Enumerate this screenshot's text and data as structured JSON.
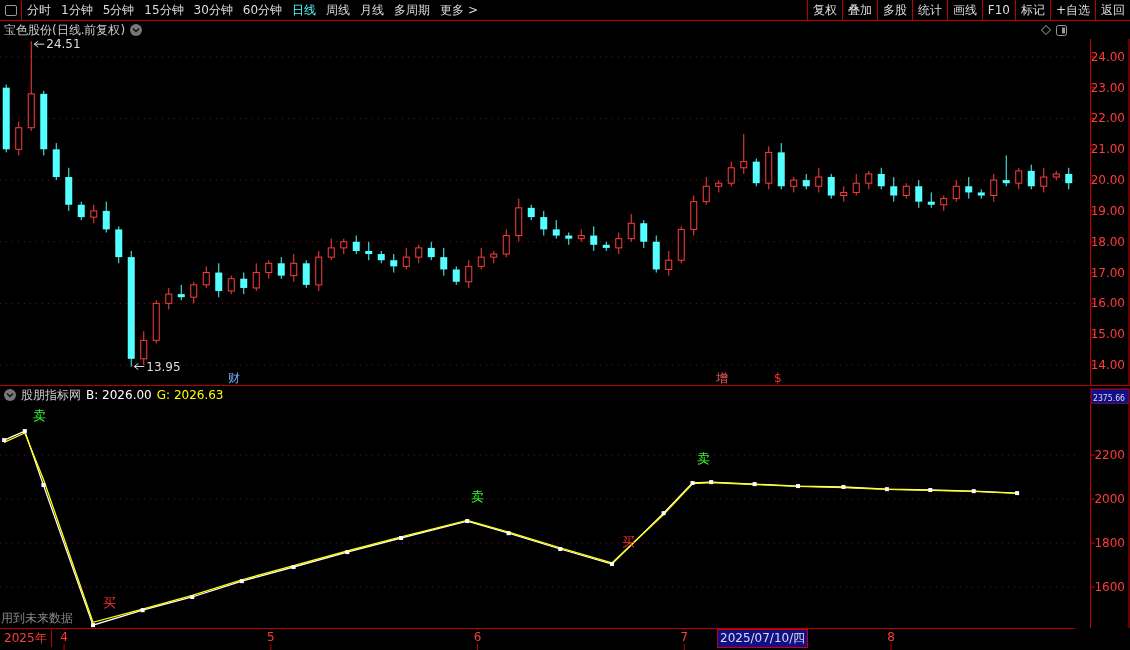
{
  "toolbar": {
    "periods": [
      {
        "label": "分时",
        "selected": false
      },
      {
        "label": "1分钟",
        "selected": false
      },
      {
        "label": "5分钟",
        "selected": false
      },
      {
        "label": "15分钟",
        "selected": false
      },
      {
        "label": "30分钟",
        "selected": false
      },
      {
        "label": "60分钟",
        "selected": false
      },
      {
        "label": "日线",
        "selected": true
      },
      {
        "label": "周线",
        "selected": false
      },
      {
        "label": "月线",
        "selected": false
      },
      {
        "label": "多周期",
        "selected": false
      },
      {
        "label": "更多 >",
        "selected": false
      }
    ],
    "buttons": [
      "复权",
      "叠加",
      "多股",
      "统计",
      "画线",
      "F10",
      "标记",
      "+自选",
      "返回"
    ]
  },
  "price_chart": {
    "title": "宝色股份(日线.前复权)",
    "high_label": "24.51",
    "low_label": "13.95",
    "events": [
      {
        "label": "财",
        "kind": "finance"
      },
      {
        "label": "增",
        "kind": "increase"
      },
      {
        "label": "$",
        "kind": "dividend"
      }
    ],
    "chart_data": {
      "type": "candlestick",
      "ylim": [
        13.35,
        24.58
      ],
      "grid": true,
      "yticks": [
        {
          "value": 24,
          "label": "24.00"
        },
        {
          "value": 23,
          "label": "23.00"
        },
        {
          "value": 22,
          "label": "22.00"
        },
        {
          "value": 21,
          "label": "21.00"
        },
        {
          "value": 20,
          "label": "20.00"
        },
        {
          "value": 19,
          "label": "19.00"
        },
        {
          "value": 18,
          "label": "18.00"
        },
        {
          "value": 17,
          "label": "17.00"
        },
        {
          "value": 16,
          "label": "16.00"
        },
        {
          "value": 15,
          "label": "15.00"
        },
        {
          "value": 14,
          "label": "14.00"
        }
      ],
      "categories": [
        null,
        null,
        null,
        null,
        null,
        null,
        null,
        null,
        null,
        null,
        null,
        null,
        null,
        null,
        null,
        null,
        null,
        null,
        null,
        null,
        null,
        null,
        null,
        null,
        null,
        null,
        null,
        null,
        null,
        null,
        null,
        null,
        null,
        null,
        null,
        null,
        null,
        null,
        null,
        null,
        null,
        null,
        null,
        null,
        null,
        null,
        null,
        null,
        null,
        null,
        null,
        null,
        null,
        null,
        null,
        null,
        null,
        null,
        null,
        null,
        null,
        null,
        null,
        null,
        null,
        null,
        null,
        null,
        null,
        null,
        null,
        null,
        null,
        null,
        null,
        null,
        null,
        null,
        null,
        null,
        null,
        null,
        null,
        null,
        null,
        null
      ],
      "ohlc": [
        [
          23.0,
          23.1,
          20.9,
          21.0
        ],
        [
          21.0,
          21.9,
          20.8,
          21.7
        ],
        [
          21.7,
          24.51,
          21.6,
          22.8
        ],
        [
          22.8,
          22.9,
          20.8,
          21.0
        ],
        [
          21.0,
          21.2,
          20.0,
          20.1
        ],
        [
          20.1,
          20.4,
          19.0,
          19.2
        ],
        [
          19.2,
          19.3,
          18.7,
          18.8
        ],
        [
          18.8,
          19.2,
          18.6,
          19.0
        ],
        [
          19.0,
          19.3,
          18.3,
          18.4
        ],
        [
          18.4,
          18.5,
          17.3,
          17.5
        ],
        [
          17.5,
          17.7,
          13.95,
          14.2
        ],
        [
          14.2,
          15.1,
          14.0,
          14.8
        ],
        [
          14.8,
          16.1,
          14.7,
          16.0
        ],
        [
          16.0,
          16.5,
          15.8,
          16.3
        ],
        [
          16.3,
          16.6,
          16.1,
          16.2
        ],
        [
          16.2,
          16.7,
          16.0,
          16.6
        ],
        [
          16.6,
          17.2,
          16.5,
          17.0
        ],
        [
          17.0,
          17.3,
          16.2,
          16.4
        ],
        [
          16.4,
          16.9,
          16.3,
          16.8
        ],
        [
          16.8,
          17.0,
          16.3,
          16.5
        ],
        [
          16.5,
          17.3,
          16.4,
          17.0
        ],
        [
          17.0,
          17.4,
          16.8,
          17.3
        ],
        [
          17.3,
          17.5,
          16.8,
          16.9
        ],
        [
          16.9,
          17.6,
          16.7,
          17.3
        ],
        [
          17.3,
          17.4,
          16.5,
          16.6
        ],
        [
          16.6,
          17.7,
          16.4,
          17.5
        ],
        [
          17.5,
          18.1,
          17.4,
          17.8
        ],
        [
          17.8,
          18.1,
          17.6,
          18.0
        ],
        [
          18.0,
          18.2,
          17.6,
          17.7
        ],
        [
          17.7,
          18.0,
          17.4,
          17.6
        ],
        [
          17.6,
          17.7,
          17.3,
          17.4
        ],
        [
          17.4,
          17.6,
          17.0,
          17.2
        ],
        [
          17.2,
          17.8,
          17.1,
          17.5
        ],
        [
          17.5,
          17.9,
          17.3,
          17.8
        ],
        [
          17.8,
          18.0,
          17.4,
          17.5
        ],
        [
          17.5,
          17.8,
          16.9,
          17.1
        ],
        [
          17.1,
          17.2,
          16.6,
          16.7
        ],
        [
          16.7,
          17.4,
          16.5,
          17.2
        ],
        [
          17.2,
          17.8,
          17.1,
          17.5
        ],
        [
          17.5,
          17.7,
          17.3,
          17.6
        ],
        [
          17.6,
          18.4,
          17.5,
          18.2
        ],
        [
          18.2,
          19.4,
          18.0,
          19.1
        ],
        [
          19.1,
          19.2,
          18.7,
          18.8
        ],
        [
          18.8,
          19.0,
          18.2,
          18.4
        ],
        [
          18.4,
          18.7,
          18.1,
          18.2
        ],
        [
          18.2,
          18.3,
          17.9,
          18.1
        ],
        [
          18.1,
          18.4,
          18.0,
          18.2
        ],
        [
          18.2,
          18.5,
          17.7,
          17.9
        ],
        [
          17.9,
          18.0,
          17.7,
          17.8
        ],
        [
          17.8,
          18.3,
          17.6,
          18.1
        ],
        [
          18.1,
          18.9,
          18.0,
          18.6
        ],
        [
          18.6,
          18.7,
          17.8,
          18.0
        ],
        [
          18.0,
          18.2,
          17.0,
          17.1
        ],
        [
          17.1,
          17.7,
          16.9,
          17.4
        ],
        [
          17.4,
          18.5,
          17.3,
          18.4
        ],
        [
          18.4,
          19.5,
          18.2,
          19.3
        ],
        [
          19.3,
          20.1,
          19.2,
          19.8
        ],
        [
          19.8,
          20.0,
          19.6,
          19.9
        ],
        [
          19.9,
          20.6,
          19.8,
          20.4
        ],
        [
          20.4,
          21.5,
          20.2,
          20.6
        ],
        [
          20.6,
          20.7,
          19.8,
          19.9
        ],
        [
          19.9,
          21.1,
          19.7,
          20.9
        ],
        [
          20.9,
          21.2,
          19.7,
          19.8
        ],
        [
          19.8,
          20.1,
          19.6,
          20.0
        ],
        [
          20.0,
          20.2,
          19.7,
          19.8
        ],
        [
          19.8,
          20.4,
          19.6,
          20.1
        ],
        [
          20.1,
          20.2,
          19.4,
          19.5
        ],
        [
          19.5,
          19.8,
          19.3,
          19.6
        ],
        [
          19.6,
          20.2,
          19.5,
          19.9
        ],
        [
          19.9,
          20.3,
          19.7,
          20.2
        ],
        [
          20.2,
          20.4,
          19.7,
          19.8
        ],
        [
          19.8,
          20.1,
          19.3,
          19.5
        ],
        [
          19.5,
          19.9,
          19.4,
          19.8
        ],
        [
          19.8,
          20.0,
          19.1,
          19.3
        ],
        [
          19.3,
          19.6,
          19.1,
          19.2
        ],
        [
          19.2,
          19.5,
          19.0,
          19.4
        ],
        [
          19.4,
          20.0,
          19.3,
          19.8
        ],
        [
          19.8,
          20.1,
          19.4,
          19.6
        ],
        [
          19.6,
          19.7,
          19.4,
          19.5
        ],
        [
          19.5,
          20.2,
          19.3,
          20.0
        ],
        [
          20.0,
          20.8,
          19.8,
          19.9
        ],
        [
          19.9,
          20.4,
          19.7,
          20.3
        ],
        [
          20.3,
          20.5,
          19.7,
          19.8
        ],
        [
          19.8,
          20.4,
          19.6,
          20.1
        ],
        [
          20.1,
          20.3,
          20.0,
          20.2
        ],
        [
          20.2,
          20.4,
          19.7,
          19.9
        ]
      ]
    }
  },
  "indicator": {
    "title": "股朋指标网",
    "legend": [
      {
        "text": "B: 2026.00",
        "color": "#ffffff"
      },
      {
        "text": "G: 2026.63",
        "color": "#ffff00"
      }
    ],
    "top_value": "2375.66",
    "note": "用到未来数据",
    "signals": [
      {
        "kind": "sell",
        "label": "卖"
      },
      {
        "kind": "buy",
        "label": "买"
      },
      {
        "kind": "sell",
        "label": "卖"
      },
      {
        "kind": "buy",
        "label": "买"
      },
      {
        "kind": "sell",
        "label": "卖"
      }
    ],
    "chart_data": {
      "type": "line",
      "x": [
        3.71,
        3.81,
        3.9,
        4.14,
        4.38,
        4.62,
        4.86,
        5.11,
        5.37,
        5.63,
        5.95,
        6.15,
        6.4,
        6.65,
        6.9,
        7.04,
        7.13,
        7.34,
        7.55,
        7.77,
        7.98,
        8.19,
        8.4,
        8.61
      ],
      "xlim": [
        3.69,
        8.89
      ],
      "ylim": [
        1414,
        2432
      ],
      "yticks": [
        1600,
        1800,
        2000,
        2200
      ],
      "xticks": [
        4,
        5,
        6,
        7,
        8
      ],
      "grid": true,
      "series": [
        {
          "color": "#ffffff",
          "marker": "square",
          "values": [
            2268,
            2309,
            2064,
            1427,
            1495,
            1555,
            1627,
            1691,
            1759,
            1823,
            1900,
            1845,
            1773,
            1705,
            1936,
            2073,
            2077,
            2068,
            2059,
            2055,
            2045,
            2041,
            2036,
            2027
          ]
        },
        {
          "color": "#ffff00",
          "values": [
            2258,
            2300,
            2090,
            1440,
            1500,
            1562,
            1633,
            1697,
            1764,
            1828,
            1903,
            1850,
            1778,
            1710,
            1930,
            2070,
            2075,
            2066,
            2058,
            2052,
            2044,
            2040,
            2035,
            2026
          ]
        }
      ]
    }
  },
  "time_axis": {
    "year": "2025年",
    "cursor_date": "2025/07/10/四"
  }
}
